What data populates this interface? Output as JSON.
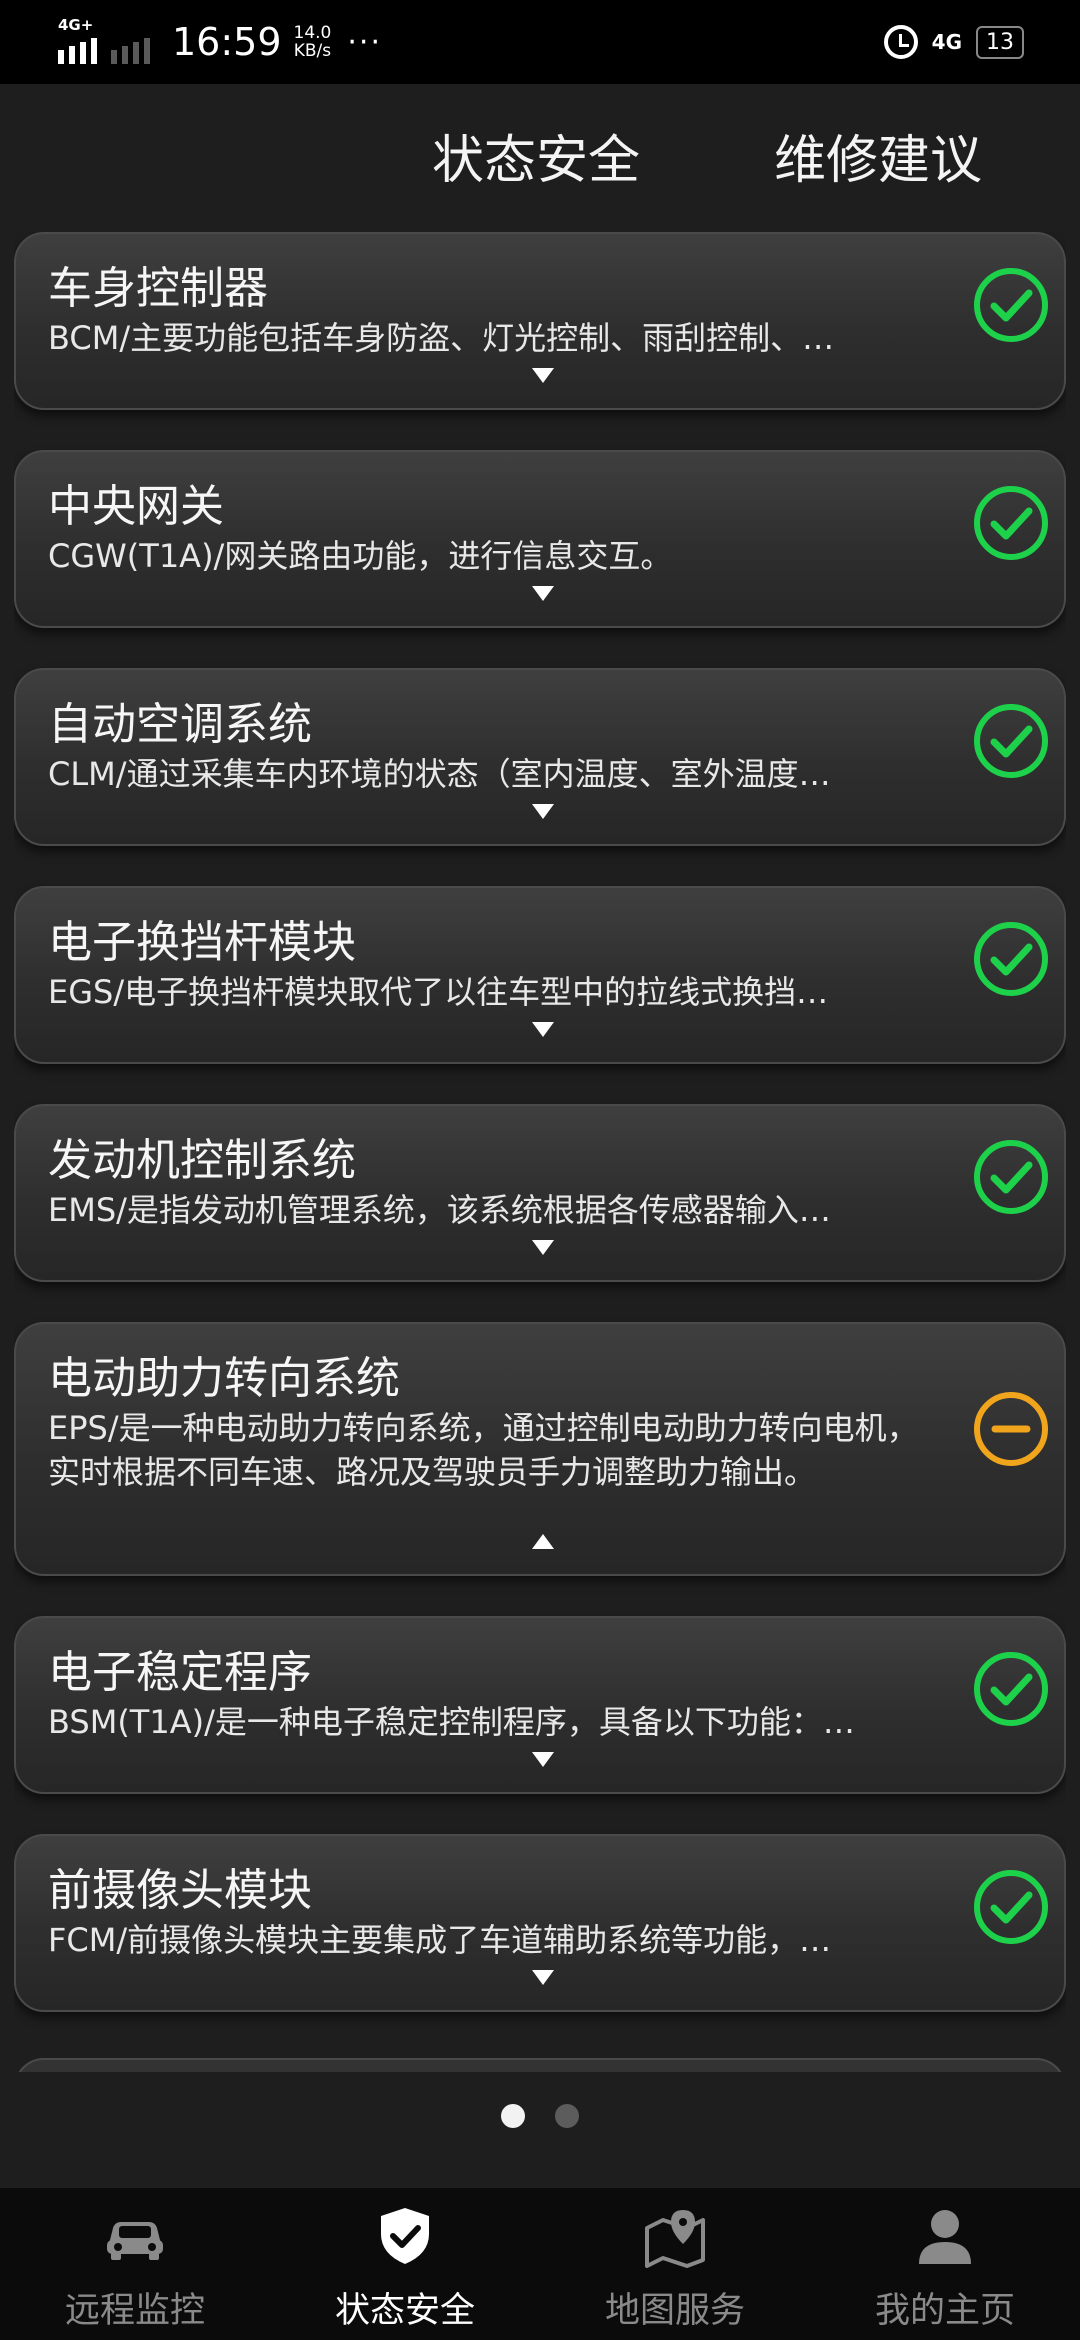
{
  "status_bar": {
    "network_left": "4G+",
    "time": "16:59",
    "speed_value": "14.0",
    "speed_unit": "KB/s",
    "more": "···",
    "network_right": "4G",
    "battery": "13"
  },
  "header": {
    "tabs": [
      {
        "label": "状态安全"
      },
      {
        "label": "维修建议"
      }
    ]
  },
  "modules": [
    {
      "title": "车身控制器",
      "desc": "BCM/主要功能包括车身防盗、灯光控制、雨刮控制、…",
      "status": "ok",
      "expanded": false
    },
    {
      "title": "中央网关",
      "desc": "CGW(T1A)/网关路由功能，进行信息交互。",
      "status": "ok",
      "expanded": false
    },
    {
      "title": "自动空调系统",
      "desc": "CLM/通过采集车内环境的状态（室内温度、室外温度…",
      "status": "ok",
      "expanded": false
    },
    {
      "title": "电子换挡杆模块",
      "desc": "EGS/电子换挡杆模块取代了以往车型中的拉线式换挡…",
      "status": "ok",
      "expanded": false
    },
    {
      "title": "发动机控制系统",
      "desc": "EMS/是指发动机管理系统，该系统根据各传感器输入…",
      "status": "ok",
      "expanded": false
    },
    {
      "title": "电动助力转向系统",
      "desc": "EPS/是一种电动助力转向系统，通过控制电动助力转向电机，实时根据不同车速、路况及驾驶员手力调整助力输出。",
      "status": "warning",
      "expanded": true
    },
    {
      "title": "电子稳定程序",
      "desc": "BSM(T1A)/是一种电子稳定控制程序，具备以下功能：…",
      "status": "ok",
      "expanded": false
    },
    {
      "title": "前摄像头模块",
      "desc": "FCM/前摄像头模块主要集成了车道辅助系统等功能，…",
      "status": "ok",
      "expanded": false
    }
  ],
  "colors": {
    "ok": "#1ed14b",
    "warning": "#f0a51c"
  },
  "pager": {
    "current": 1,
    "total": 2
  },
  "bottom_nav": {
    "items": [
      {
        "label": "远程监控",
        "icon": "car-icon",
        "active": false
      },
      {
        "label": "状态安全",
        "icon": "shield-check-icon",
        "active": true
      },
      {
        "label": "地图服务",
        "icon": "map-pin-icon",
        "active": false
      },
      {
        "label": "我的主页",
        "icon": "user-icon",
        "active": false
      }
    ]
  }
}
